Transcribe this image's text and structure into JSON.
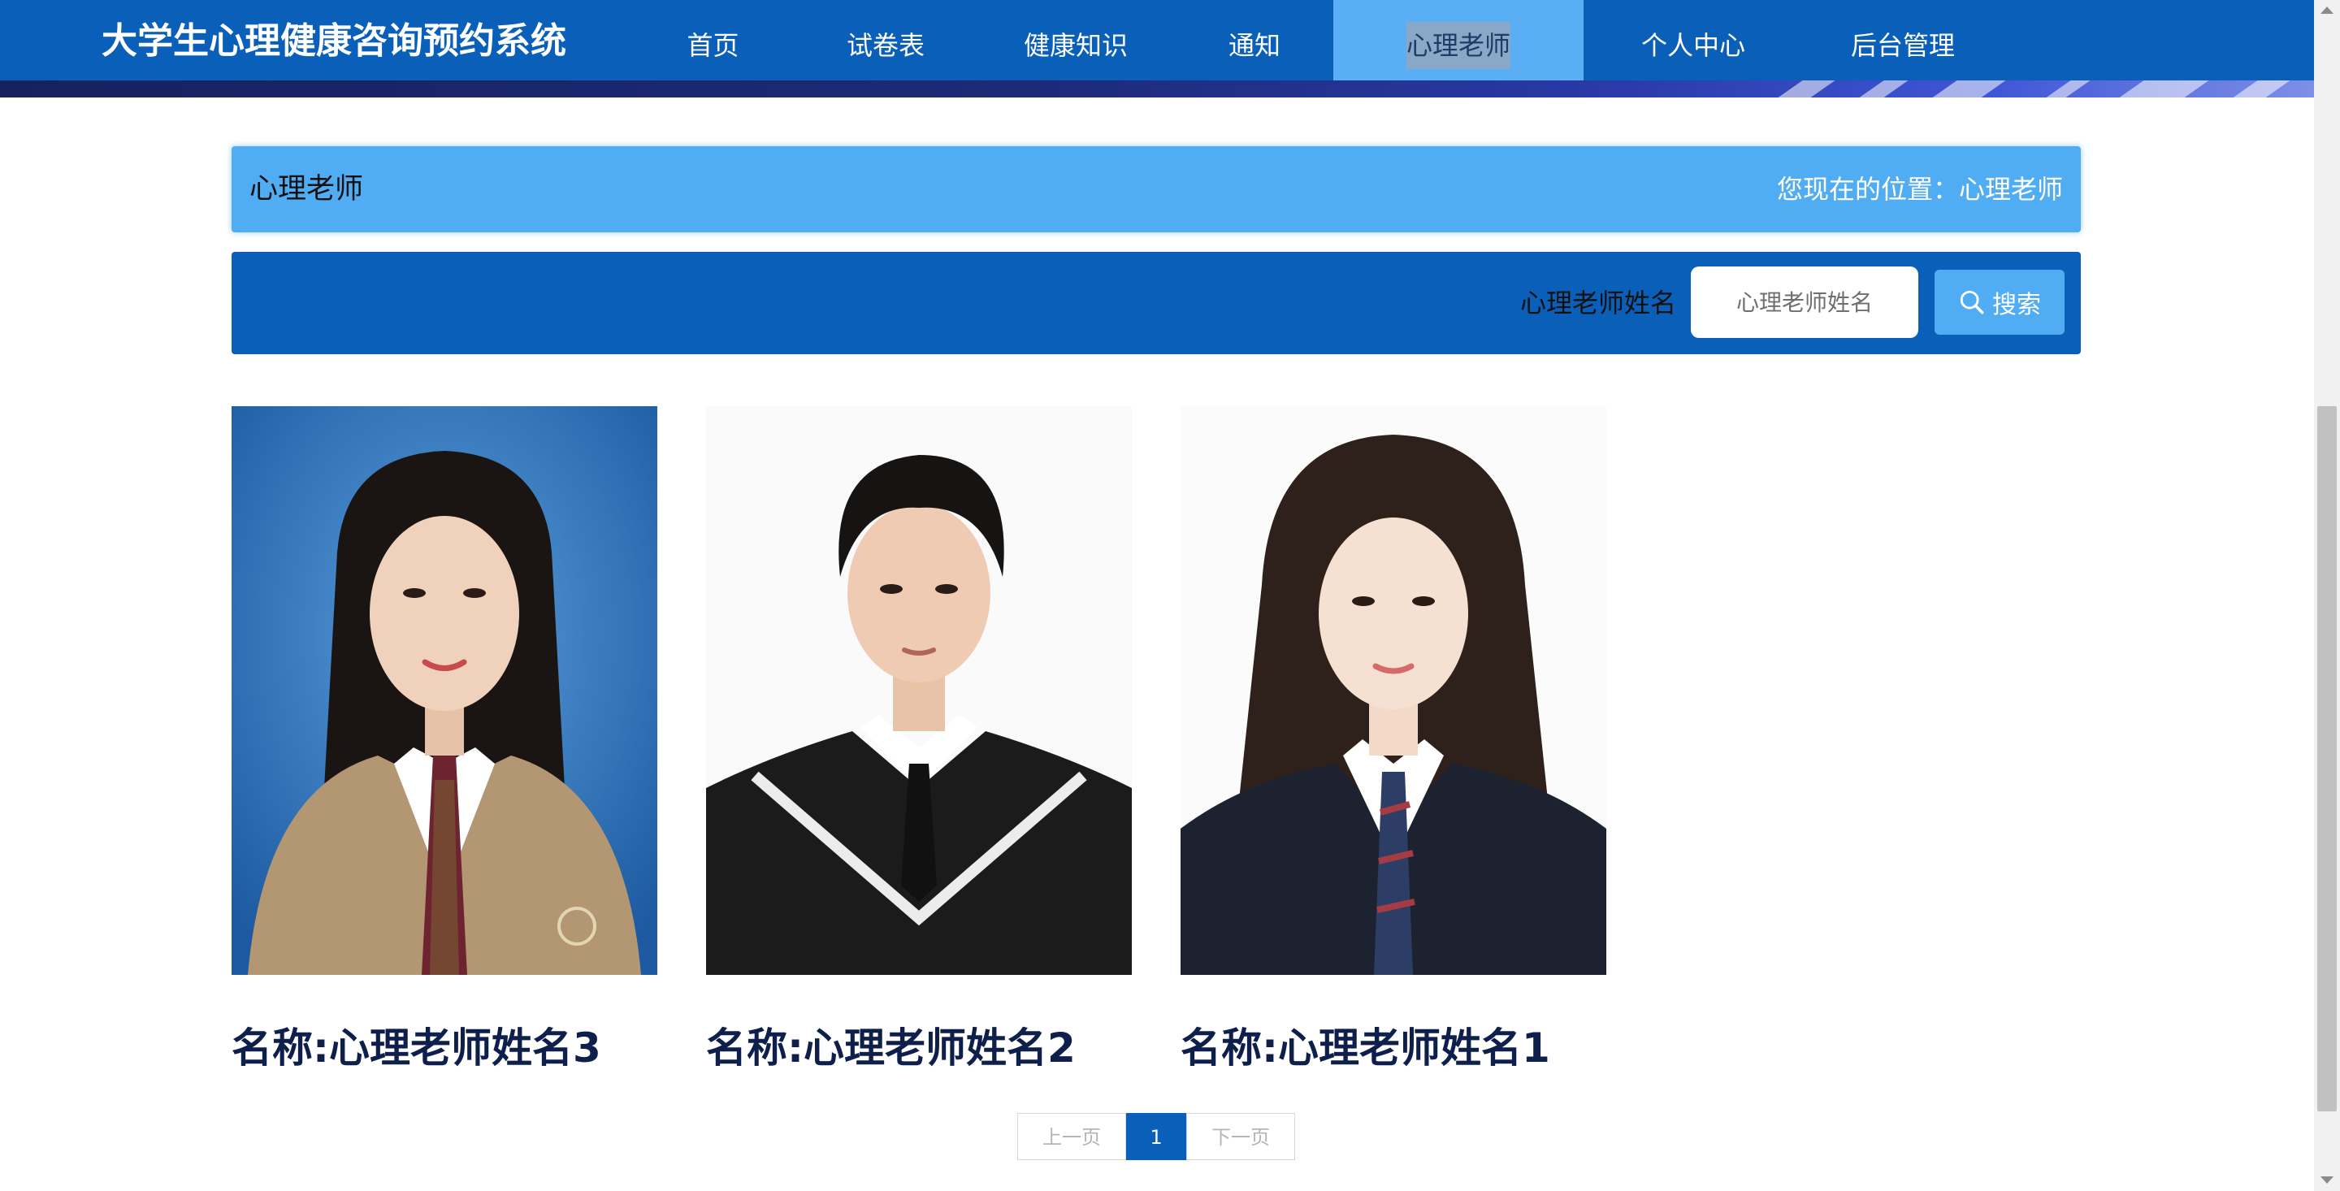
{
  "site": {
    "title": "大学生心理健康咨询预约系统"
  },
  "nav": {
    "items": [
      {
        "label": "首页"
      },
      {
        "label": "试卷表"
      },
      {
        "label": "健康知识"
      },
      {
        "label": "通知"
      },
      {
        "label": "心理老师"
      },
      {
        "label": "个人中心"
      },
      {
        "label": "后台管理"
      }
    ],
    "active_index": 4
  },
  "page": {
    "title": "心理老师",
    "breadcrumb": "您现在的位置：心理老师"
  },
  "search": {
    "label": "心理老师姓名",
    "placeholder": "心理老师姓名",
    "value": "",
    "button_label": "搜索"
  },
  "teachers": [
    {
      "name": "名称:心理老师姓名3",
      "photo": "female-student-portrait-tan-blazer-blue-background"
    },
    {
      "name": "名称:心理老师姓名2",
      "photo": "male-student-portrait-black-vest-white-background"
    },
    {
      "name": "名称:心理老师姓名1",
      "photo": "female-student-portrait-black-blazer-white-background"
    }
  ],
  "pagination": {
    "prev": "上一页",
    "current": "1",
    "next": "下一页"
  },
  "colors": {
    "nav_bg": "#0a5fb8",
    "nav_active": "#5aaef4",
    "header_bar": "#51adf3",
    "card_title": "#0d1f4a"
  }
}
